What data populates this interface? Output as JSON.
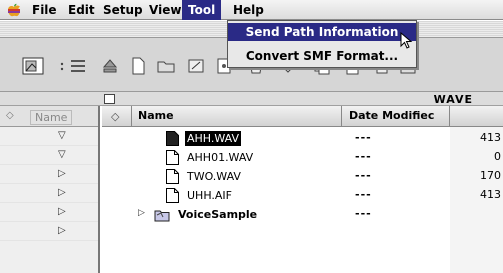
{
  "menubar": {
    "apple_icon": "apple-icon",
    "items": [
      {
        "label": "File"
      },
      {
        "label": "Edit"
      },
      {
        "label": "Setup"
      },
      {
        "label": "View"
      },
      {
        "label": "Tool"
      },
      {
        "label": "Help"
      }
    ],
    "active_index": 4
  },
  "tool_menu": {
    "items": [
      {
        "label": "Send Path Information",
        "highlighted": true
      },
      {
        "label": "Convert SMF Format...",
        "highlighted": false
      }
    ]
  },
  "window": {
    "folder_title": "WAVE"
  },
  "left_panel": {
    "header": "Name"
  },
  "file_list": {
    "columns": {
      "name": "Name",
      "date": "Date Modifiec"
    },
    "rows": [
      {
        "name": "AHH.WAV",
        "date": "---",
        "size": "413",
        "selected": true,
        "kind": "file"
      },
      {
        "name": "AHH01.WAV",
        "date": "---",
        "size": "0",
        "selected": false,
        "kind": "file"
      },
      {
        "name": "TWO.WAV",
        "date": "---",
        "size": "170",
        "selected": false,
        "kind": "file"
      },
      {
        "name": "UHH.AIF",
        "date": "---",
        "size": "413",
        "selected": false,
        "kind": "file"
      },
      {
        "name": "VoiceSample",
        "date": "---",
        "size": "",
        "selected": false,
        "kind": "folder"
      }
    ]
  },
  "colors": {
    "menu_highlight": "#2a2a86",
    "selection": "#000000"
  }
}
